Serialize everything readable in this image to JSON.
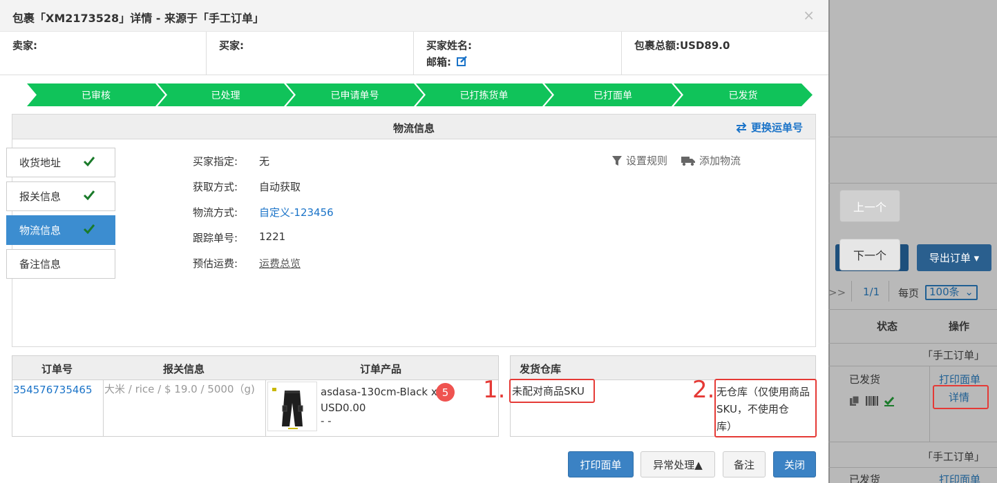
{
  "modal": {
    "title": "包裹「XM2173528」详情 - 来源于「手工订单」",
    "close_glyph": "×"
  },
  "info": {
    "seller_label": "卖家:",
    "buyer_label": "买家:",
    "buyer_name_label": "买家姓名:",
    "email_label": "邮箱:",
    "total_label": "包裹总额:",
    "total_value": "USD89.0"
  },
  "steps": [
    "已审核",
    "已处理",
    "已申请单号",
    "已打拣货单",
    "已打面单",
    "已发货"
  ],
  "logistics": {
    "title": "物流信息",
    "change_link": "更换运单号",
    "fields": [
      {
        "label": "买家指定:",
        "value": "无"
      },
      {
        "label": "获取方式:",
        "value": "自动获取"
      },
      {
        "label": "物流方式:",
        "value": "自定义-123456"
      },
      {
        "label": "跟踪单号:",
        "value": "1221"
      },
      {
        "label": "预估运费:",
        "value": "运费总览"
      }
    ],
    "tools": {
      "set_rule": "设置规则",
      "add_logistics": "添加物流"
    }
  },
  "side_tabs": [
    {
      "label": "收货地址",
      "active": false
    },
    {
      "label": "报关信息",
      "active": false
    },
    {
      "label": "物流信息",
      "active": true
    },
    {
      "label": "备注信息",
      "active": false
    }
  ],
  "order_table": {
    "headers": [
      "订单号",
      "报关信息",
      "订单产品"
    ],
    "row": {
      "order_no": "354576735465",
      "customs": "大米 / rice / $ 19.0 / 5000（g)",
      "product_line1": "asdasa-130cm-Black x",
      "product_line2": "USD0.00",
      "product_line3": "- -",
      "qty_badge": "5"
    }
  },
  "warehouse": {
    "header": "发货仓库",
    "left_text": "未配对商品SKU",
    "right_line1": "无仓库（仅使用商品",
    "right_line2": "SKU，不使用仓",
    "right_line3": "库）",
    "marker1": "1.",
    "marker2": "2."
  },
  "footer": {
    "print": "打印面单",
    "exception": "异常处理▲",
    "note": "备注",
    "close": "关闭"
  },
  "background": {
    "prev": "上一个",
    "next": "下一个",
    "export": "导出订单 ▾",
    "pager_arrows": ">>",
    "pager_pages": "1/1",
    "per_page_label": "每页",
    "per_page_value": "100条",
    "col_status": "状态",
    "col_action": "操作",
    "group_label": "「手工订单」",
    "status_shipped": "已发货",
    "print_label": "打印面单",
    "detail_link": "详情"
  },
  "colors": {
    "step_green": "#10c35a",
    "accent_blue": "#3b82c4",
    "link_blue": "#1a73c8",
    "annotation_red": "#e53935"
  }
}
